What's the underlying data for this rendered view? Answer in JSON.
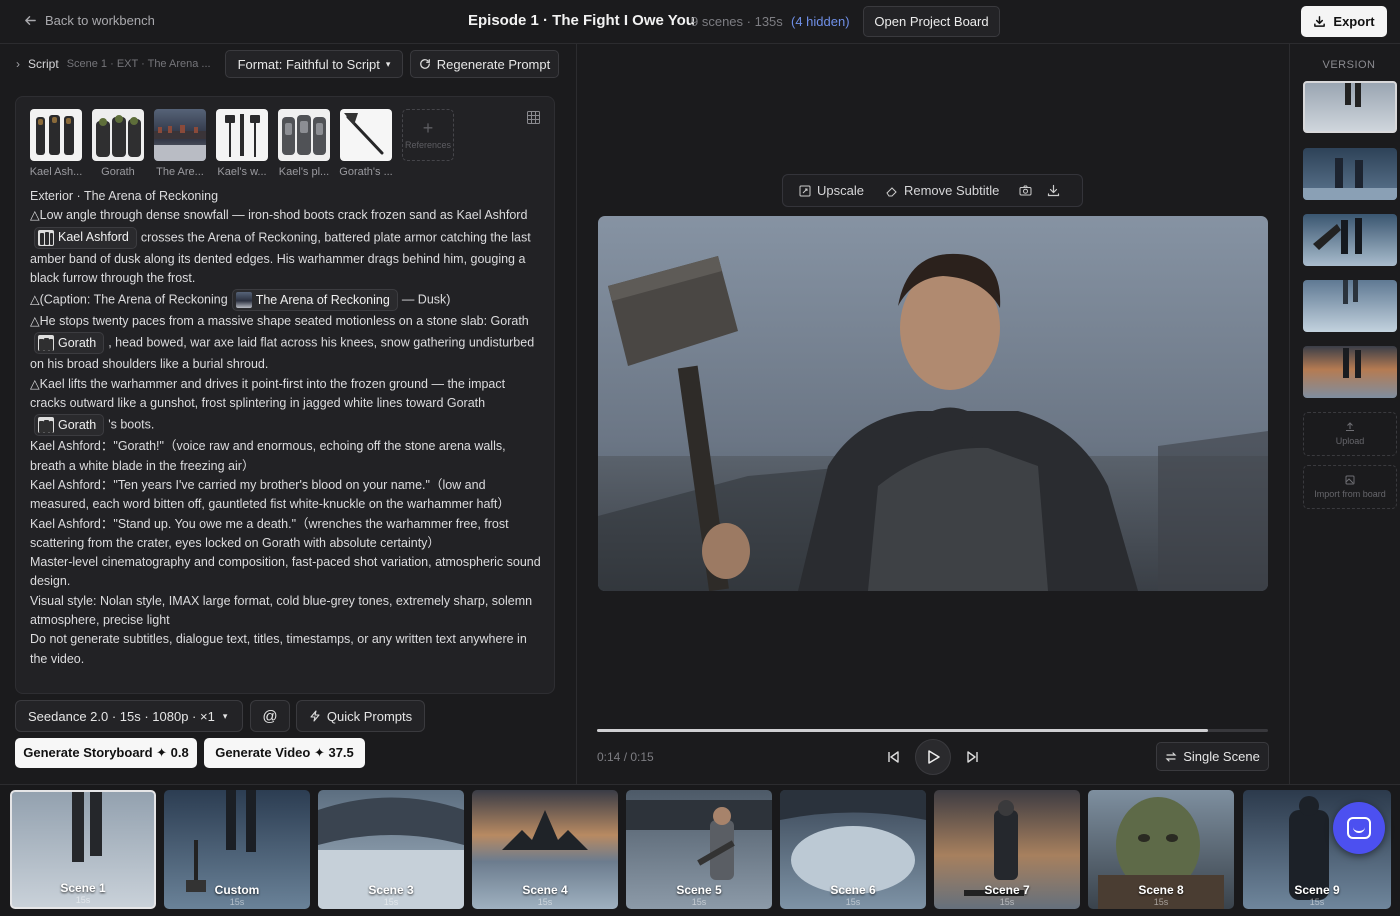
{
  "header": {
    "back_label": "Back to workbench",
    "title": "Episode 1 · The Fight I Owe You",
    "meta": "9 scenes · 135s",
    "hidden": "(4 hidden)",
    "board_label": "Open Project Board",
    "export_label": "Export"
  },
  "left": {
    "script_label": "Script",
    "script_crumb": "Scene 1 · EXT · The Arena ...",
    "format_label": "Format: Faithful to Script",
    "regen_label": "Regenerate Prompt",
    "refs": [
      {
        "name": "Kael Ash...",
        "theme": "k"
      },
      {
        "name": "Gorath",
        "theme": "g"
      },
      {
        "name": "The Are...",
        "theme": "a"
      },
      {
        "name": "Kael's w...",
        "theme": "h"
      },
      {
        "name": "Kael's pl...",
        "theme": "p"
      },
      {
        "name": "Gorath's ...",
        "theme": "x"
      }
    ],
    "refs_add": "References",
    "script": {
      "heading": "Exterior · The Arena of Reckoning",
      "p1a": "△Low angle through dense snowfall — iron-shod boots crack frozen sand as Kael Ashford",
      "chip_kael": "Kael Ashford",
      "p1b": "crosses the Arena of Reckoning, battered plate armor catching the last amber band of dusk along its dented edges. His warhammer drags behind him, gouging a black furrow through the frost.",
      "p2a": "△(Caption: The Arena of Reckoning",
      "chip_arena": "The Arena of Reckoning",
      "p2b": "— Dusk)",
      "p3a": "△He stops twenty paces from a massive shape seated motionless on a stone slab: Gorath",
      "chip_gorath": "Gorath",
      "p3b": ", head bowed, war axe laid flat across his knees, snow gathering undisturbed on his broad shoulders like a burial shroud.",
      "p4a": "△Kael lifts the warhammer and drives it point-first into the frozen ground — the impact cracks outward like a gunshot, frost splintering in jagged white lines toward Gorath",
      "chip_gorath2": "Gorath",
      "p4b": "'s boots.",
      "p5": "Kael Ashford：\"Gorath!\"（voice raw and enormous, echoing off the stone arena walls, breath a white blade in the freezing air）",
      "p6": "Kael Ashford：\"Ten years I've carried my brother's blood on your name.\"（low and measured, each word bitten off, gauntleted fist white-knuckle on the warhammer haft）",
      "p7": "Kael Ashford：\"Stand up. You owe me a death.\"（wrenches the warhammer free, frost scattering from the crater, eyes locked on Gorath with absolute certainty）",
      "p8": "Master-level cinematography and composition, fast-paced shot variation, atmospheric sound design.",
      "p9": "Visual style: Nolan style, IMAX large format, cold blue-grey tones, extremely sharp, solemn atmosphere, precise light",
      "p10": "Do not generate subtitles, dialogue text, titles, timestamps, or any written text anywhere in the video."
    },
    "model_label": "Seedance 2.0 · 15s · 1080p · ×1",
    "at_label": "@",
    "quick_label": "Quick Prompts",
    "gen_storyboard": "Generate Storyboard ✦ 0.8",
    "gen_video": "Generate Video ✦ 37.5"
  },
  "preview": {
    "upscale_label": "Upscale",
    "remove_subtitle_label": "Remove Subtitle",
    "time": "0:14 / 0:15",
    "progress": 0.91,
    "single_scene_label": "Single Scene"
  },
  "versions": {
    "title": "VERSION",
    "upload_label": "Upload",
    "import_label": "Import from board"
  },
  "scenes": [
    {
      "label": "Scene 1",
      "dur": "15s"
    },
    {
      "label": "Custom",
      "dur": "15s"
    },
    {
      "label": "Scene 3",
      "dur": "15s"
    },
    {
      "label": "Scene 4",
      "dur": "15s"
    },
    {
      "label": "Scene 5",
      "dur": "15s"
    },
    {
      "label": "Scene 6",
      "dur": "15s"
    },
    {
      "label": "Scene 7",
      "dur": "15s"
    },
    {
      "label": "Scene 8",
      "dur": "15s"
    },
    {
      "label": "Scene 9",
      "dur": "15s"
    }
  ],
  "colors": {
    "accent": "#6f8fe6",
    "fab": "#4c50f0"
  }
}
